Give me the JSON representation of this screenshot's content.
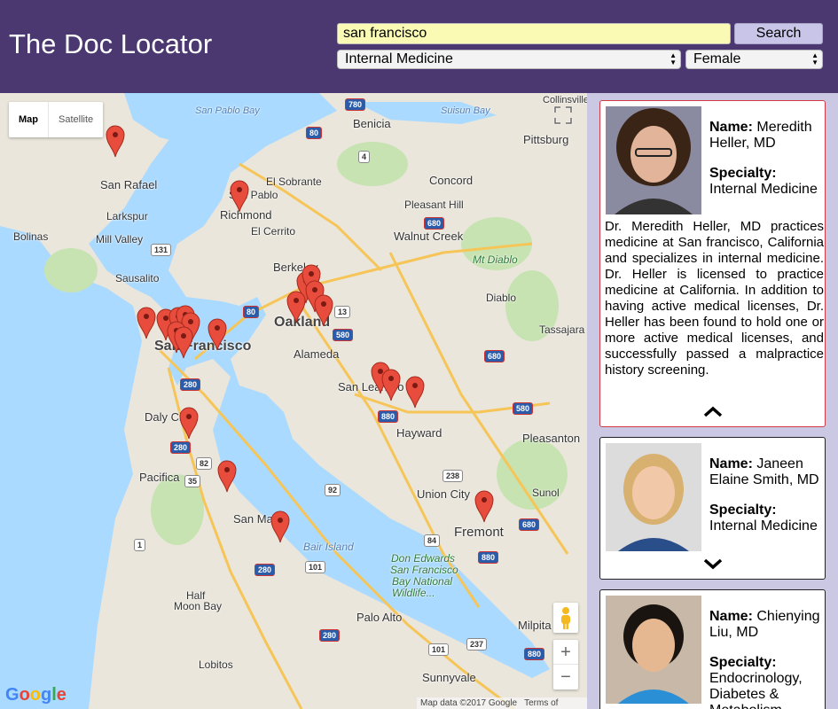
{
  "header": {
    "title": "The Doc Locator",
    "search_value": "san francisco",
    "search_button": "Search",
    "specialty_selected": "Internal Medicine",
    "gender_selected": "Female"
  },
  "map": {
    "type_map": "Map",
    "type_satellite": "Satellite",
    "attribution": "Map data ©2017 Google",
    "terms": "Terms of Use",
    "logo": "Google",
    "zoom_in": "+",
    "zoom_out": "−",
    "labels": {
      "san_pablo_bay": "San Pablo Bay",
      "suisun_bay": "Suisun Bay",
      "benicia": "Benicia",
      "pittsburg": "Pittsburg",
      "collinsville": "Collinsville",
      "san_rafael": "San Rafael",
      "el_sobrante": "El Sobrante",
      "san_pablo": "San Pablo",
      "richmond": "Richmond",
      "concord": "Concord",
      "larkspur": "Larkspur",
      "pleasant_hill": "Pleasant Hill",
      "bolinas": "Bolinas",
      "mill_valley": "Mill Valley",
      "el_cerrito": "El Cerrito",
      "walnut_creek": "Walnut Creek",
      "mt_diablo": "Mt Diablo",
      "sausalito": "Sausalito",
      "berkeley": "Berkeley",
      "diablo": "Diablo",
      "oakland": "Oakland",
      "tassajara": "Tassajara",
      "san_francisco": "San Francisco",
      "alameda": "Alameda",
      "san_leandro": "San Leandro",
      "daly_city": "Daly City",
      "hayward": "Hayward",
      "pleasanton": "Pleasanton",
      "pacifica": "Pacifica",
      "union_city": "Union City",
      "sunol": "Sunol",
      "san_mateo": "San Mateo",
      "fremont": "Fremont",
      "bair_island": "Bair Island",
      "don_edwards_1": "Don Edwards",
      "don_edwards_2": "San Francisco",
      "don_edwards_3": "Bay National",
      "don_edwards_4": "Wildlife...",
      "half_moon_bay_1": "Half",
      "half_moon_bay_2": "Moon Bay",
      "palo_alto": "Palo Alto",
      "milpitas": "Milpita",
      "lobitos": "Lobitos",
      "sunnyvale": "Sunnyvale"
    },
    "shields": {
      "i780": "780",
      "i80a": "80",
      "r4": "4",
      "r131": "131",
      "i680a": "680",
      "i80b": "80",
      "r13": "13",
      "i580a": "580",
      "i680b": "680",
      "i280a": "280",
      "i880": "880",
      "i580b": "580",
      "i280b": "280",
      "r82": "82",
      "r35": "35",
      "r92": "92",
      "r238": "238",
      "r84": "84",
      "i680c": "680",
      "r1": "1",
      "i880b": "880",
      "r101": "101",
      "i280c": "280",
      "i280d": "280",
      "r237": "237",
      "i880c": "880",
      "r101b": "101"
    },
    "pin_count": 22
  },
  "results": [
    {
      "name_label": "Name:",
      "name": "Meredith Heller, MD",
      "specialty_label": "Specialty:",
      "specialty": "Internal Medicine",
      "description": "Dr. Meredith Heller, MD practices medicine at San francisco, California and specializes in internal medicine. Dr. Heller is licensed to practice medicine at California. In addition to having active medical licenses, Dr. Heller has been found to hold one or more active medical licenses, and successfully passed a malpractice history screening.",
      "expanded": true
    },
    {
      "name_label": "Name:",
      "name": "Janeen Elaine Smith, MD",
      "specialty_label": "Specialty:",
      "specialty": "Internal Medicine",
      "expanded": false
    },
    {
      "name_label": "Name:",
      "name": "Chienying Liu, MD",
      "specialty_label": "Specialty:",
      "specialty": "Endocrinology, Diabetes & Metabolism",
      "expanded": false
    }
  ],
  "colors": {
    "header_bg": "#4b3870",
    "search_bg": "#fafab4",
    "panel_bg": "#cbc8e3",
    "active_border": "#d23a46",
    "pin": "#e74c3c"
  }
}
